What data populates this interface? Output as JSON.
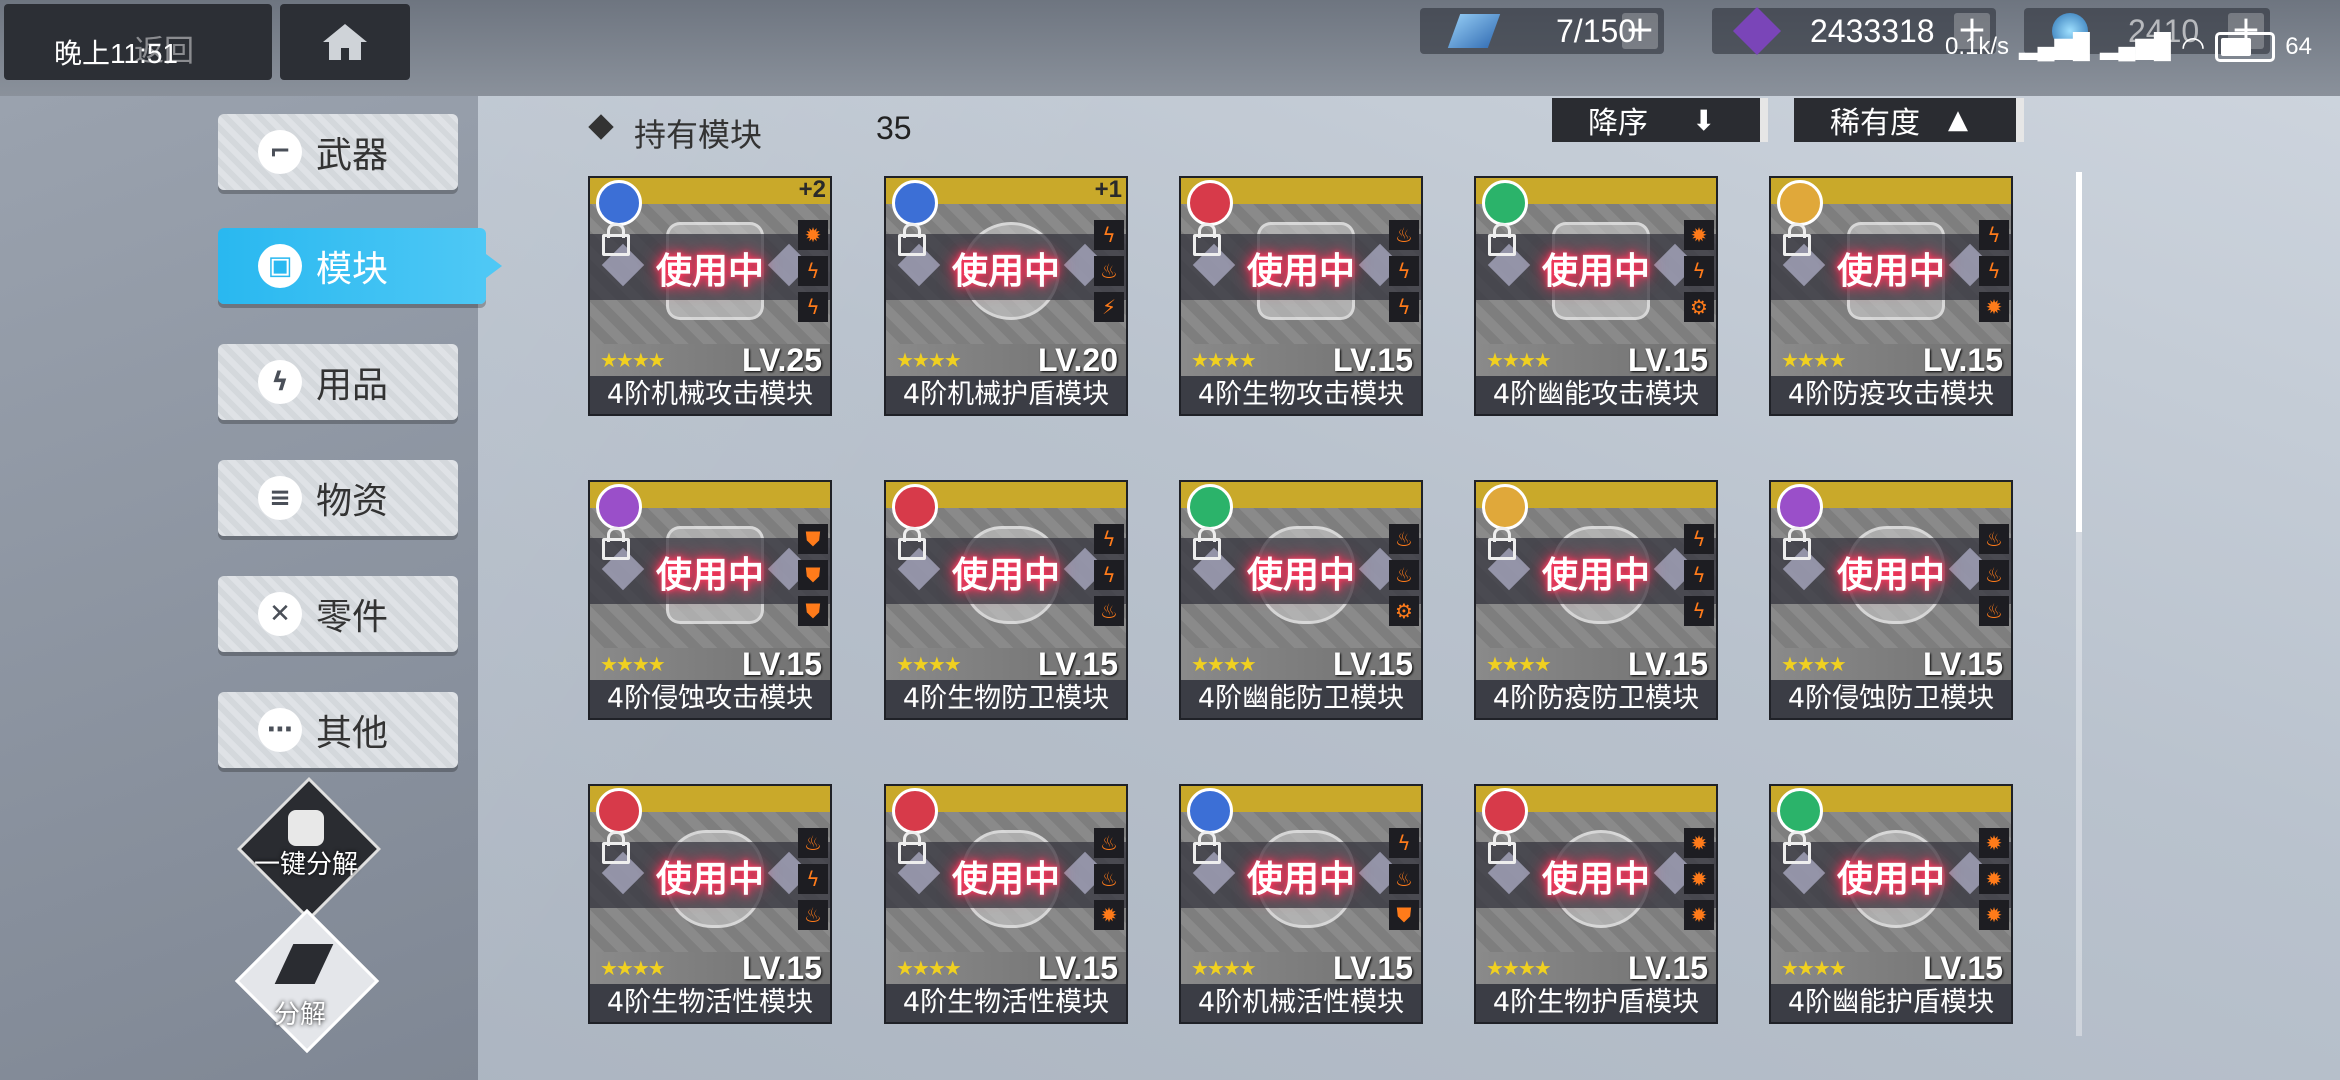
{
  "status_bar": {
    "time": "晚上11:51",
    "net_speed": "0.1k/s",
    "battery": "64"
  },
  "topbar": {
    "back_label": "返回",
    "resources": [
      {
        "icon": "capacity-icon",
        "value": "7/150"
      },
      {
        "icon": "purple-crystal-icon",
        "value": "2433318"
      },
      {
        "icon": "blue-orb-icon",
        "value": "2410"
      }
    ]
  },
  "sidebar": {
    "items": [
      {
        "label": "武器",
        "icon": "weapon-icon",
        "glyph": "⌐",
        "active": false
      },
      {
        "label": "模块",
        "icon": "module-icon",
        "glyph": "▣",
        "active": true
      },
      {
        "label": "用品",
        "icon": "lightning-icon",
        "glyph": "ϟ",
        "active": false
      },
      {
        "label": "物资",
        "icon": "supplies-icon",
        "glyph": "≡",
        "active": false
      },
      {
        "label": "零件",
        "icon": "parts-icon",
        "glyph": "✕",
        "active": false
      },
      {
        "label": "其他",
        "icon": "more-icon",
        "glyph": "⋯",
        "active": false
      }
    ],
    "quick_dismantle_label": "一键分解",
    "dismantle_label": "分解"
  },
  "header": {
    "title": "持有模块",
    "count": "35",
    "sort_label": "降序",
    "rarity_label": "稀有度"
  },
  "colors": {
    "accent": "#29b8f0",
    "card_top": "#c9a92a",
    "in_use_glow": "#ff2d55"
  },
  "cards": [
    {
      "name": "4阶机械攻击模块",
      "level": "LV.25",
      "badge": "#3c6fd6",
      "plus": "+2",
      "status": "使用中",
      "stars": "★★★★",
      "shape": "sq",
      "stats": [
        "✹",
        "ϟ",
        "ϟ"
      ]
    },
    {
      "name": "4阶机械护盾模块",
      "level": "LV.20",
      "badge": "#3c6fd6",
      "plus": "+1",
      "status": "使用中",
      "stars": "★★★★",
      "shape": "",
      "stats": [
        "ϟ",
        "♨",
        "⚡"
      ]
    },
    {
      "name": "4阶生物攻击模块",
      "level": "LV.15",
      "badge": "#d73a4a",
      "plus": "",
      "status": "使用中",
      "stars": "★★★★",
      "shape": "sq",
      "stats": [
        "♨",
        "ϟ",
        "ϟ"
      ]
    },
    {
      "name": "4阶幽能攻击模块",
      "level": "LV.15",
      "badge": "#2bb36a",
      "plus": "",
      "status": "使用中",
      "stars": "★★★★",
      "shape": "sq",
      "stats": [
        "✹",
        "ϟ",
        "⚙"
      ]
    },
    {
      "name": "4阶防疫攻击模块",
      "level": "LV.15",
      "badge": "#e0a83a",
      "plus": "",
      "status": "使用中",
      "stars": "★★★★",
      "shape": "sq",
      "stats": [
        "ϟ",
        "ϟ",
        "✹"
      ]
    },
    {
      "name": "4阶侵蚀攻击模块",
      "level": "LV.15",
      "badge": "#9a4fc9",
      "plus": "",
      "status": "使用中",
      "stars": "★★★★",
      "shape": "sq",
      "stats": [
        "⛊",
        "⛊",
        "⛊"
      ]
    },
    {
      "name": "4阶生物防卫模块",
      "level": "LV.15",
      "badge": "#d73a4a",
      "plus": "",
      "status": "使用中",
      "stars": "★★★★",
      "shape": "heart",
      "stats": [
        "ϟ",
        "ϟ",
        "♨"
      ]
    },
    {
      "name": "4阶幽能防卫模块",
      "level": "LV.15",
      "badge": "#2bb36a",
      "plus": "",
      "status": "使用中",
      "stars": "★★★★",
      "shape": "heart",
      "stats": [
        "♨",
        "♨",
        "⚙"
      ]
    },
    {
      "name": "4阶防疫防卫模块",
      "level": "LV.15",
      "badge": "#e0a83a",
      "plus": "",
      "status": "使用中",
      "stars": "★★★★",
      "shape": "heart",
      "stats": [
        "ϟ",
        "ϟ",
        "ϟ"
      ]
    },
    {
      "name": "4阶侵蚀防卫模块",
      "level": "LV.15",
      "badge": "#9a4fc9",
      "plus": "",
      "status": "使用中",
      "stars": "★★★★",
      "shape": "heart",
      "stats": [
        "♨",
        "♨",
        "♨"
      ]
    },
    {
      "name": "4阶生物活性模块",
      "level": "LV.15",
      "badge": "#d73a4a",
      "plus": "",
      "status": "使用中",
      "stars": "★★★★",
      "shape": "heart",
      "stats": [
        "♨",
        "ϟ",
        "♨"
      ]
    },
    {
      "name": "4阶生物活性模块",
      "level": "LV.15",
      "badge": "#d73a4a",
      "plus": "",
      "status": "使用中",
      "stars": "★★★★",
      "shape": "heart",
      "stats": [
        "♨",
        "♨",
        "✹"
      ]
    },
    {
      "name": "4阶机械活性模块",
      "level": "LV.15",
      "badge": "#3c6fd6",
      "plus": "",
      "status": "使用中",
      "stars": "★★★★",
      "shape": "heart",
      "stats": [
        "ϟ",
        "♨",
        "⛊"
      ]
    },
    {
      "name": "4阶生物护盾模块",
      "level": "LV.15",
      "badge": "#d73a4a",
      "plus": "",
      "status": "使用中",
      "stars": "★★★★",
      "shape": "",
      "stats": [
        "✹",
        "✹",
        "✹"
      ]
    },
    {
      "name": "4阶幽能护盾模块",
      "level": "LV.15",
      "badge": "#2bb36a",
      "plus": "",
      "status": "使用中",
      "stars": "★★★★",
      "shape": "",
      "stats": [
        "✹",
        "✹",
        "✹"
      ]
    }
  ]
}
